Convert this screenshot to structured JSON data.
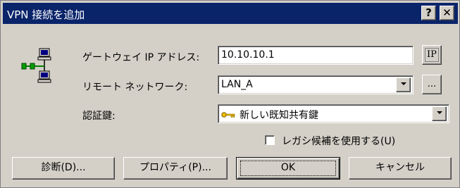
{
  "window": {
    "title": "VPN 接続を追加",
    "help_label": "?",
    "close_label": "✕"
  },
  "icons": {
    "vpn": "network-computers-icon",
    "key": "key-icon"
  },
  "form": {
    "gateway_label": "ゲートウェイ IP アドレス:",
    "gateway_value": "10.10.10.1",
    "ip_button_label": "IP",
    "remote_label": "リモート ネットワーク:",
    "remote_value": "LAN_A",
    "browse_label": "...",
    "auth_label": "認証鍵:",
    "auth_value": "新しい既知共有鍵",
    "legacy_checkbox_label": "レガシ候補を使用する(U)",
    "legacy_checked": false
  },
  "buttons": {
    "diagnose": "診断(D)...",
    "properties": "プロパティ(P)...",
    "ok": "OK",
    "cancel": "キャンセル"
  },
  "colors": {
    "titlebar": "#0a246a",
    "face": "#d4d0c8"
  }
}
